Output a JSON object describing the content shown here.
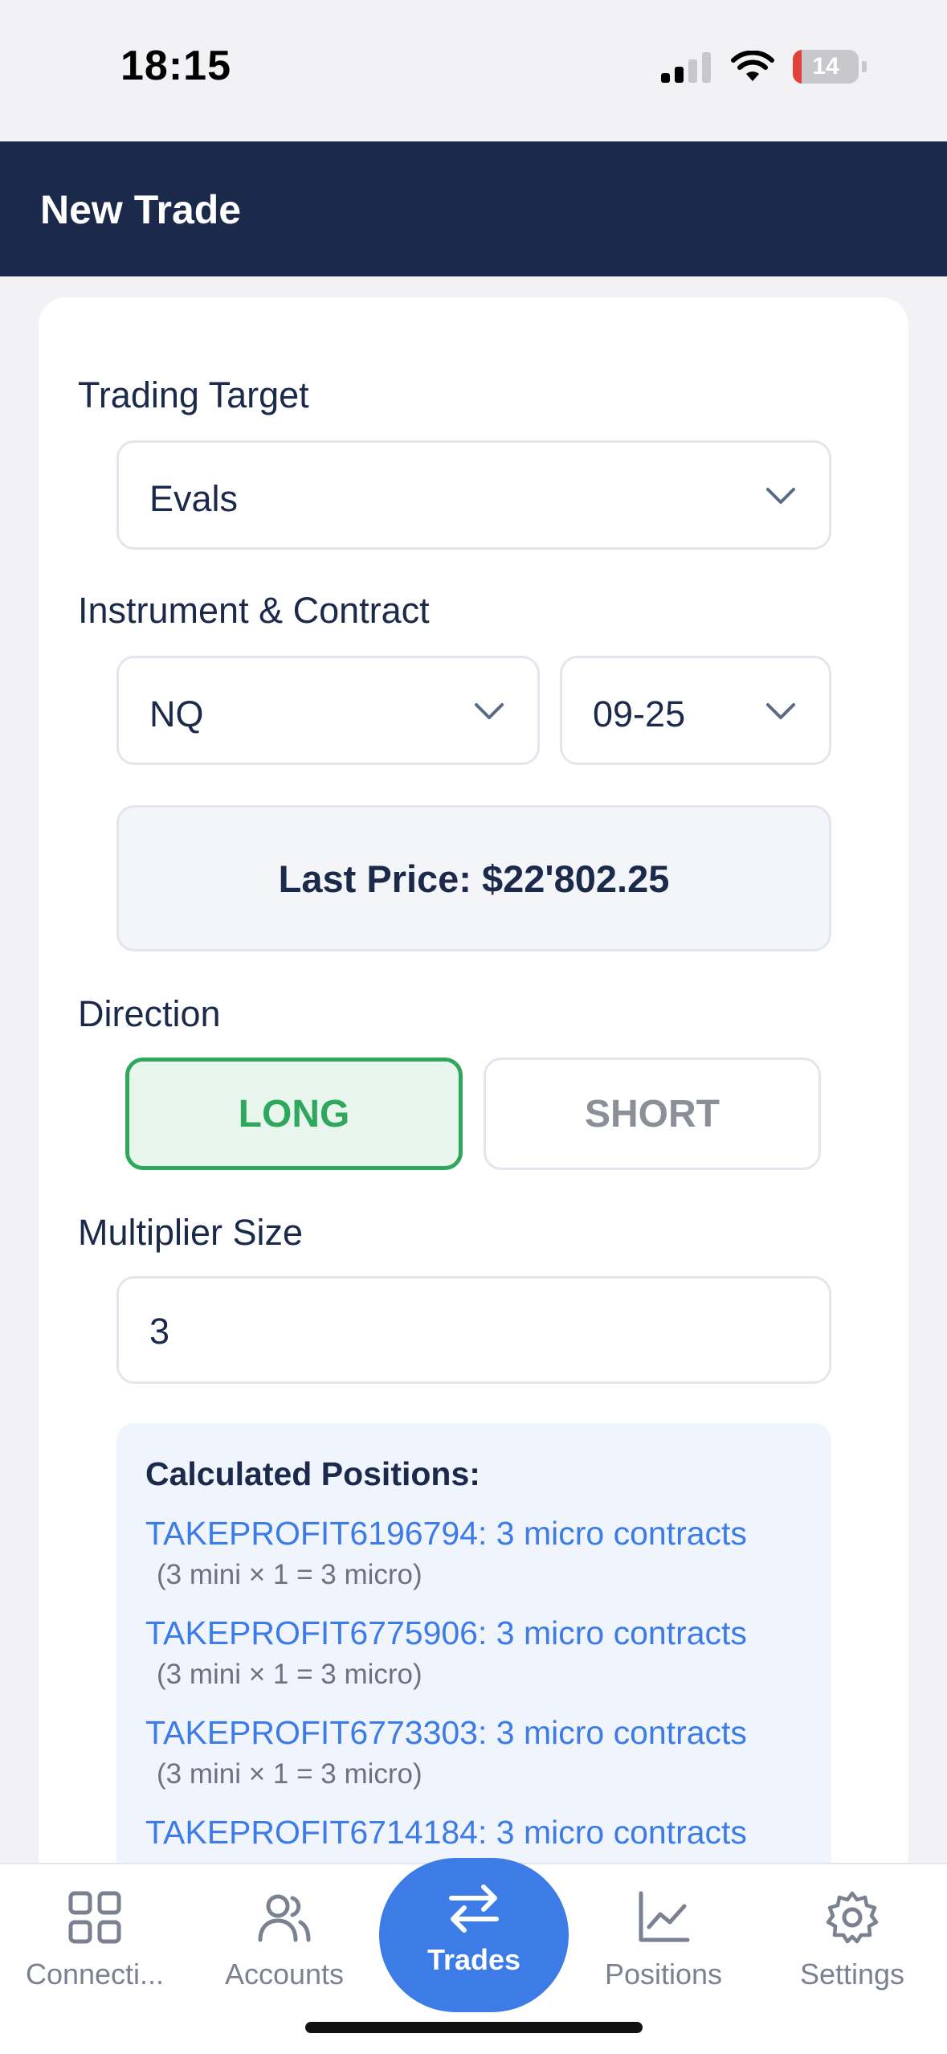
{
  "status": {
    "time": "18:15",
    "battery": "14"
  },
  "header": {
    "title": "New Trade"
  },
  "form": {
    "trading_target_label": "Trading Target",
    "trading_target_value": "Evals",
    "instrument_label": "Instrument & Contract",
    "instrument_value": "NQ",
    "contract_value": "09-25",
    "last_price": "Last Price: $22'802.25",
    "direction_label": "Direction",
    "long_label": "LONG",
    "short_label": "SHORT",
    "multiplier_label": "Multiplier Size",
    "multiplier_value": "3"
  },
  "calculated": {
    "title": "Calculated Positions:",
    "positions": [
      {
        "main": "TAKEPROFIT6196794: 3 micro contracts",
        "sub": "(3 mini × 1 = 3 micro)"
      },
      {
        "main": "TAKEPROFIT6775906: 3 micro contracts",
        "sub": "(3 mini × 1 = 3 micro)"
      },
      {
        "main": "TAKEPROFIT6773303: 3 micro contracts",
        "sub": "(3 mini × 1 = 3 micro)"
      },
      {
        "main": "TAKEPROFIT6714184: 3 micro contracts",
        "sub": ""
      }
    ]
  },
  "tabs": {
    "connections": "Connecti...",
    "accounts": "Accounts",
    "trades": "Trades",
    "positions": "Positions",
    "settings": "Settings"
  },
  "colors": {
    "header_bg": "#1b2a4a",
    "accent_blue": "#3d7be6",
    "long_green": "#2fa85d"
  }
}
